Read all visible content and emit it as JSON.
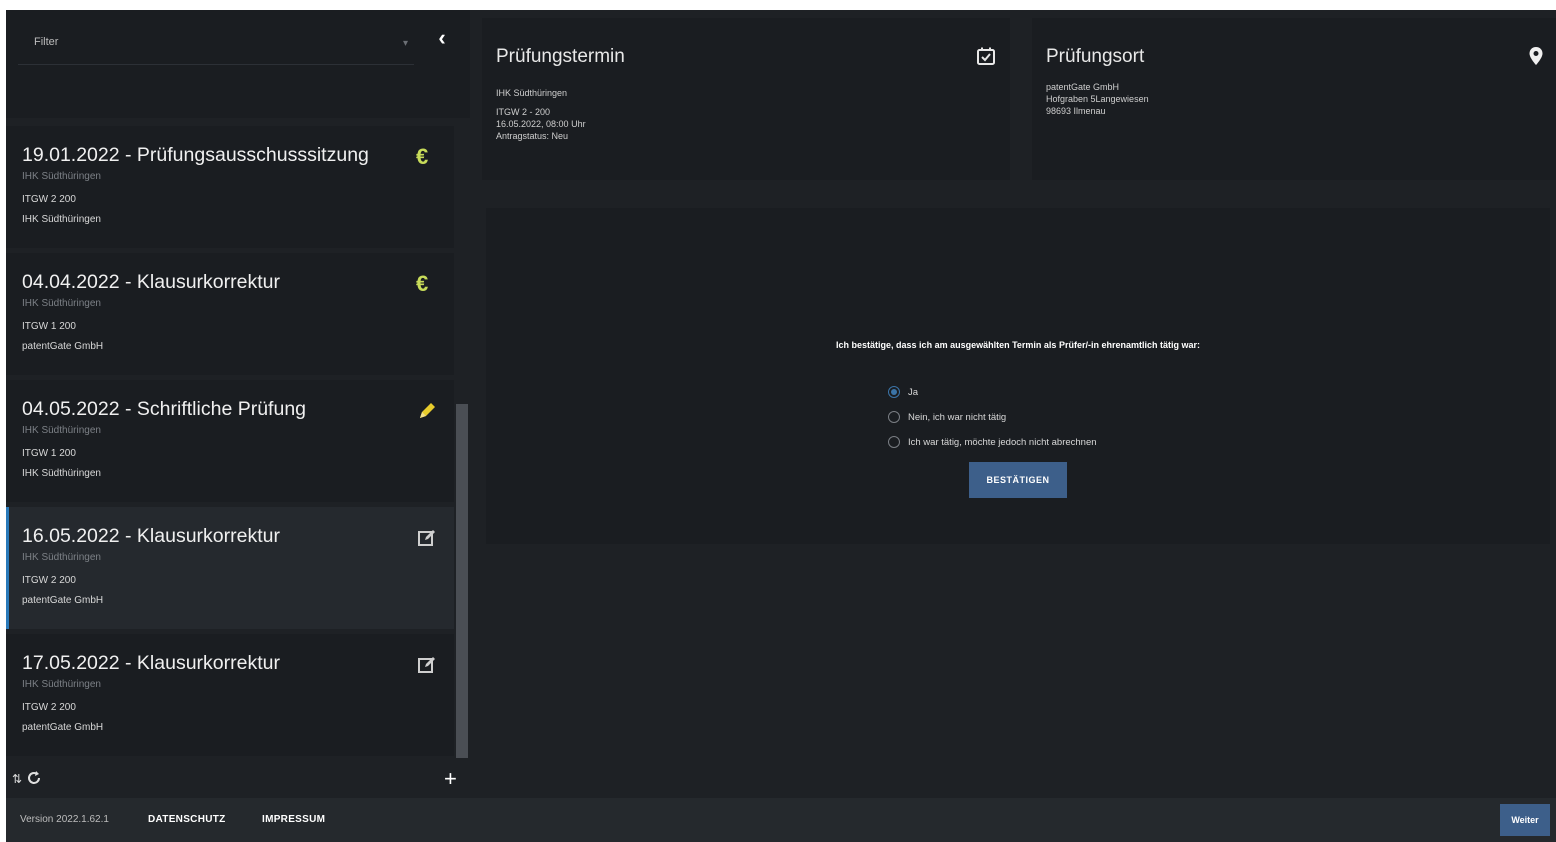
{
  "sidebar": {
    "filter_label": "Filter",
    "collapse_glyph": "‹",
    "items": [
      {
        "title": "19.01.2022 - Prüfungsausschusssitzung",
        "sub1": "IHK Südthüringen",
        "sub2": "ITGW 2 200",
        "sub3": "IHK Südthüringen",
        "icon": "euro-icon",
        "icon_glyph": "€"
      },
      {
        "title": "04.04.2022 - Klausurkorrektur",
        "sub1": "IHK Südthüringen",
        "sub2": "ITGW 1 200",
        "sub3": "patentGate GmbH",
        "icon": "euro-icon",
        "icon_glyph": "€"
      },
      {
        "title": "04.05.2022 - Schriftliche Prüfung",
        "sub1": "IHK Südthüringen",
        "sub2": "ITGW 1 200",
        "sub3": "IHK Südthüringen",
        "icon": "pencil-icon"
      },
      {
        "title": "16.05.2022 - Klausurkorrektur",
        "sub1": "IHK Südthüringen",
        "sub2": "ITGW 2 200",
        "sub3": "patentGate GmbH",
        "icon": "edit-icon",
        "active": true
      },
      {
        "title": "17.05.2022 - Klausurkorrektur",
        "sub1": "IHK Südthüringen",
        "sub2": "ITGW 2 200",
        "sub3": "patentGate GmbH",
        "icon": "edit-icon"
      }
    ],
    "footer": {
      "sort_glyph": "⇅",
      "add_glyph": "+"
    }
  },
  "termin_card": {
    "title": "Prüfungstermin",
    "lines": [
      "IHK Südthüringen",
      "ITGW 2 - 200",
      "16.05.2022, 08:00 Uhr",
      "Antragstatus: Neu"
    ],
    "icon": "calendar-check-icon"
  },
  "ort_card": {
    "title": "Prüfungsort",
    "lines": [
      "patentGate GmbH",
      "Hofgraben 5Langewiesen",
      "98693 Ilmenau"
    ],
    "icon": "map-marker-icon"
  },
  "confirm": {
    "question": "Ich bestätige, dass ich am ausgewählten Termin als Prüfer/-in ehrenamtlich tätig war:",
    "options": [
      "Ja",
      "Nein, ich war nicht tätig",
      "Ich war tätig, möchte jedoch nicht abrechnen"
    ],
    "selected_index": 0,
    "button_label": "BESTÄTIGEN"
  },
  "footer": {
    "version": "Version 2022.1.62.1",
    "datenschutz": "DATENSCHUTZ",
    "impressum": "IMPRESSUM",
    "next_label": "Weiter"
  },
  "colors": {
    "background": "#1e2125",
    "card": "#1a1d21",
    "accent": "#3d5f8a",
    "active_marker": "#2979b9",
    "euro": "#c8dc5a",
    "pencil": "#e8cc2c"
  }
}
